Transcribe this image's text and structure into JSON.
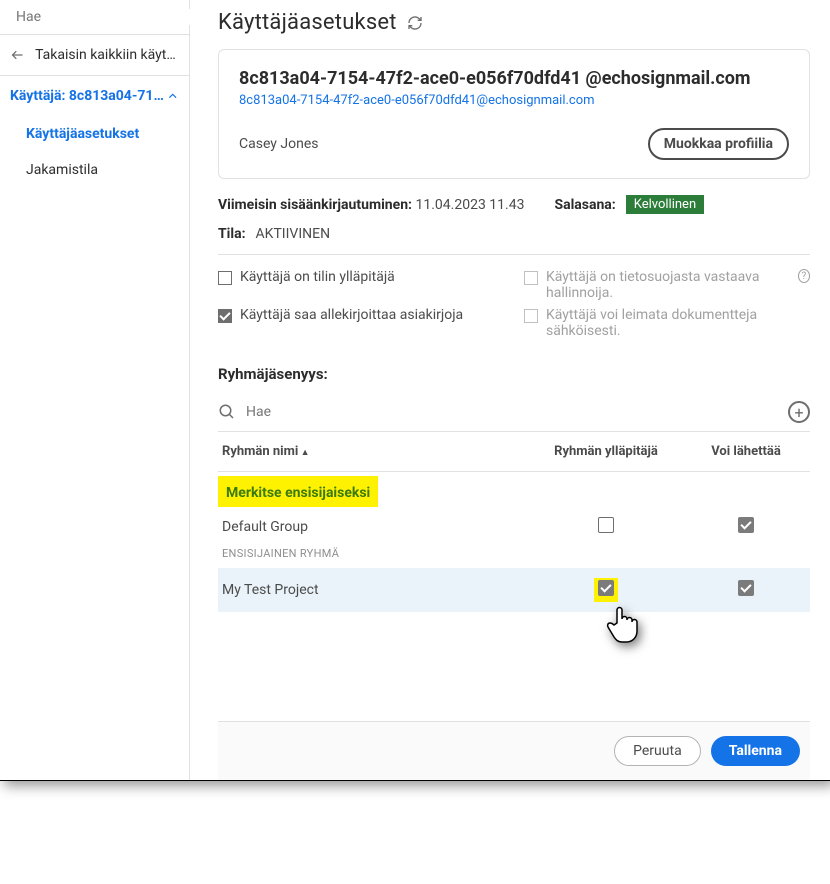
{
  "sidebar": {
    "search_placeholder": "Hae",
    "back_label": "Takaisin kaikkiin käyttä…",
    "section_label": "Käyttäjä: 8c813a04-715…",
    "items": [
      {
        "label": "Käyttäjäasetukset"
      },
      {
        "label": "Jakamistila"
      }
    ]
  },
  "page": {
    "title": "Käyttäjäasetukset"
  },
  "profile": {
    "id_name": "8c813a04-7154-47f2-ace0-e056f70dfd41 @echosignmail.com",
    "email": "8c813a04-7154-47f2-ace0-e056f70dfd41@echosignmail.com",
    "display_name": "Casey Jones",
    "edit_label": "Muokkaa profiilia"
  },
  "meta": {
    "last_login_label": "Viimeisin sisäänkirjautuminen:",
    "last_login_value": "11.04.2023 11.43",
    "password_label": "Salasana:",
    "password_badge": "Kelvollinen",
    "status_label": "Tila:",
    "status_value": "AKTIIVINEN"
  },
  "checks": {
    "c1": "Käyttäjä on tilin ylläpitäjä",
    "c2": "Käyttäjä saa allekirjoittaa asiakirjoja",
    "c3": "Käyttäjä on tietosuojasta vastaava hallinnoija.",
    "c4": "Käyttäjä voi leimata dokumentteja sähköisesti."
  },
  "groups": {
    "title": "Ryhmäjäsenyys:",
    "search_placeholder": "Hae",
    "col_name": "Ryhmän nimi",
    "col_admin": "Ryhmän ylläpitäjä",
    "col_send": "Voi lähettää",
    "highlight": "Merkitse ensisijaiseksi",
    "rows": [
      {
        "name": "Default Group",
        "sub": "ENSISIJAINEN RYHMÄ"
      },
      {
        "name": "My Test Project"
      }
    ]
  },
  "footer": {
    "cancel": "Peruuta",
    "save": "Tallenna"
  }
}
